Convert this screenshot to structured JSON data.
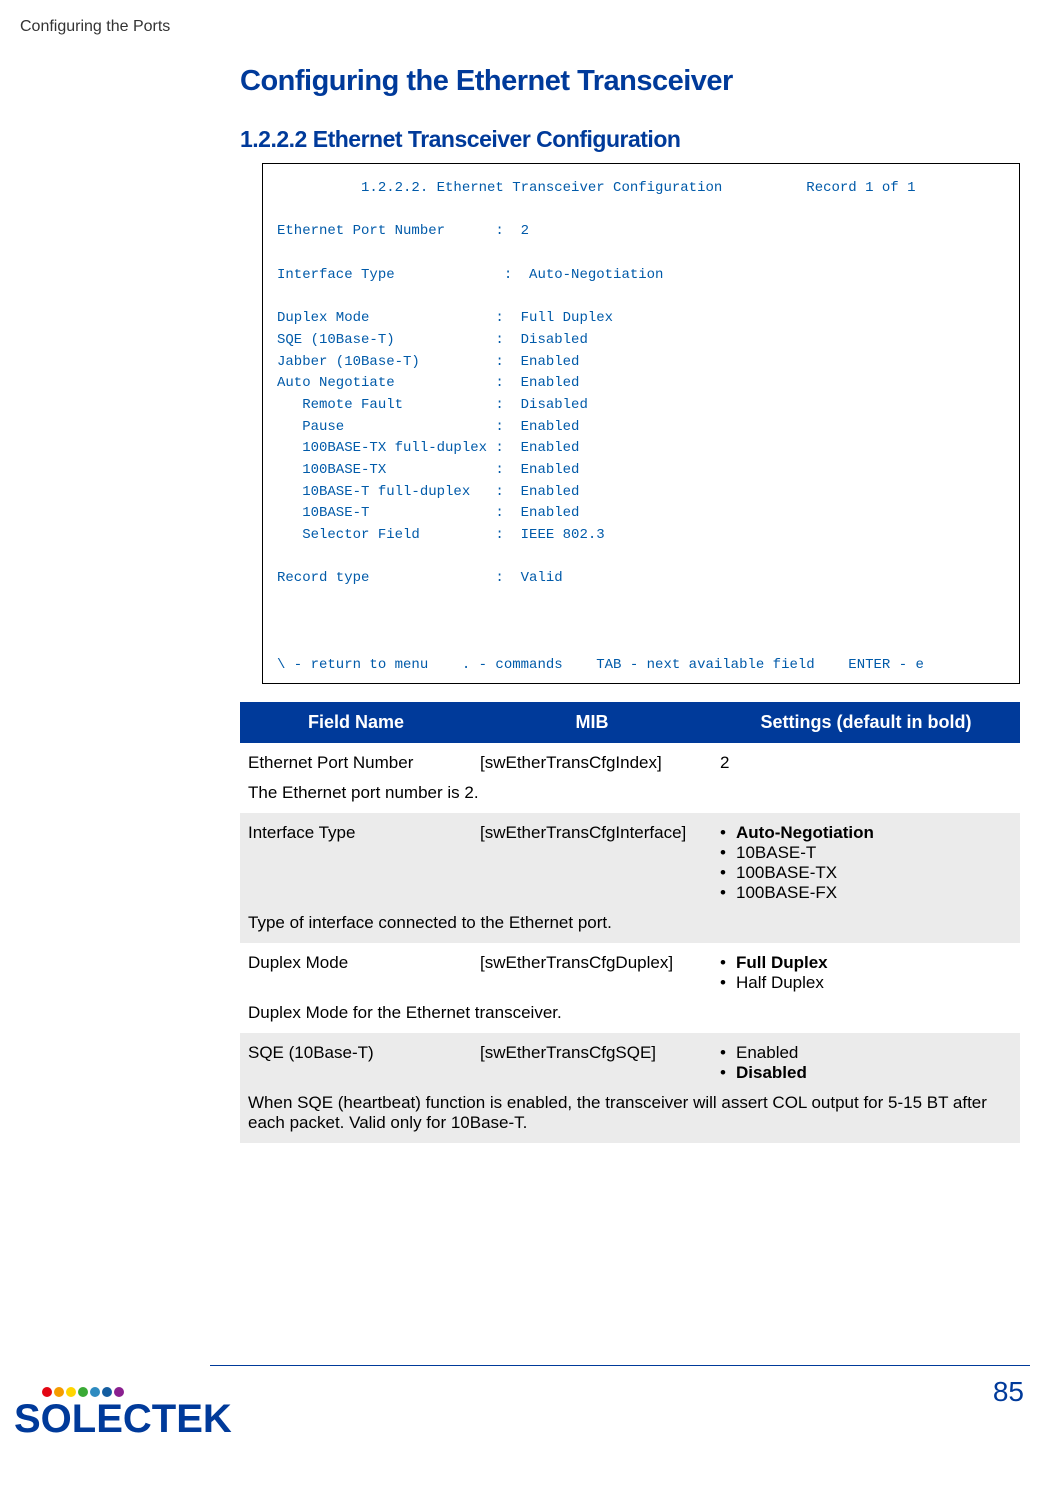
{
  "header": {
    "breadcrumb": "Configuring the Ports"
  },
  "h1": "Configuring the Ethernet Transceiver",
  "h2": "1.2.2.2 Ethernet Transceiver Configuration",
  "terminal": "          1.2.2.2. Ethernet Transceiver Configuration          Record 1 of 1\n\nEthernet Port Number      :  2\n\nInterface Type             :  Auto-Negotiation\n\nDuplex Mode               :  Full Duplex\nSQE (10Base-T)            :  Disabled\nJabber (10Base-T)         :  Enabled\nAuto Negotiate            :  Enabled\n   Remote Fault           :  Disabled\n   Pause                  :  Enabled\n   100BASE-TX full-duplex :  Enabled\n   100BASE-TX             :  Enabled\n   10BASE-T full-duplex   :  Enabled\n   10BASE-T               :  Enabled\n   Selector Field         :  IEEE 802.3\n\nRecord type               :  Valid\n\n\n\n\\ - return to menu    . - commands    TAB - next available field    ENTER - e",
  "table": {
    "headers": {
      "c1": "Field Name",
      "c2": "MIB",
      "c3": "Settings (default in bold)"
    },
    "rows": [
      {
        "shade": false,
        "field": "Ethernet Port Number",
        "mib": "[swEtherTransCfgIndex]",
        "settings": [
          {
            "text": "2",
            "bold": false,
            "bullet": false
          }
        ],
        "desc": "The Ethernet port number is 2."
      },
      {
        "shade": true,
        "field": "Interface Type",
        "mib": "[swEtherTransCfgInterface]",
        "settings": [
          {
            "text": "Auto-Negotiation",
            "bold": true,
            "bullet": true
          },
          {
            "text": "10BASE-T",
            "bold": false,
            "bullet": true
          },
          {
            "text": "100BASE-TX",
            "bold": false,
            "bullet": true
          },
          {
            "text": "100BASE-FX",
            "bold": false,
            "bullet": true
          }
        ],
        "desc": "Type of interface connected to the Ethernet port."
      },
      {
        "shade": false,
        "field": "Duplex Mode",
        "mib": "[swEtherTransCfgDuplex]",
        "settings": [
          {
            "text": "Full  Duplex",
            "bold": true,
            "bullet": true
          },
          {
            "text": "Half Duplex",
            "bold": false,
            "bullet": true
          }
        ],
        "desc": "Duplex Mode for the Ethernet transceiver."
      },
      {
        "shade": true,
        "field": "SQE (10Base-T)",
        "mib": "[swEtherTransCfgSQE]",
        "settings": [
          {
            "text": "Enabled",
            "bold": false,
            "bullet": true
          },
          {
            "text": "Disabled",
            "bold": true,
            "bullet": true
          }
        ],
        "desc": "When SQE (heartbeat) function is enabled, the transceiver will assert COL output for 5-15 BT after each packet. Valid only for 10Base-T."
      }
    ]
  },
  "footer": {
    "logo_text": "SOLECTEK",
    "page_number": "85"
  }
}
